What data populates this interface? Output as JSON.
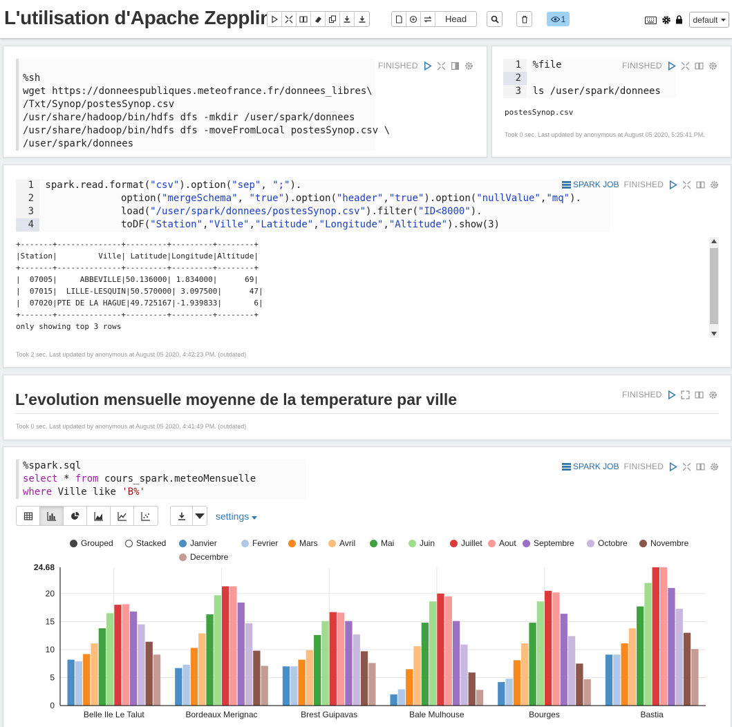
{
  "notebook": {
    "title": "L'utilisation d'Apache Zepplin",
    "head_label": "Head",
    "viewers": "1",
    "interpreter": "default"
  },
  "status_finished": "FINISHED",
  "spark_job": "SPARK JOB",
  "p1": {
    "lines": [
      "%sh",
      "wget https://donneespubliques.meteofrance.fr/donnees_libres\\",
      "/Txt/Synop/postesSynop.csv",
      "/usr/share/hadoop/bin/hdfs dfs -mkdir /user/spark/donnees",
      "/usr/share/hadoop/bin/hdfs dfs -moveFromLocal postesSynop.csv \\",
      "/user/spark/donnees"
    ]
  },
  "p2": {
    "line1": "%file",
    "line3": "ls /user/spark/donnees",
    "gutter": [
      "1",
      "2",
      "3"
    ],
    "output": "postesSynop.csv",
    "meta": "Took 0 sec. Last updated by anonymous at August 05 2020, 5:25:41 PM."
  },
  "p3": {
    "gutter": [
      "1",
      "2",
      "3",
      "4"
    ],
    "output": "+-------+--------------+---------+---------+--------+\n|Station|         Ville| Latitude|Longitude|Altitude|\n+-------+--------------+---------+---------+--------+\n|  07005|     ABBEVILLE|50.136000| 1.834000|      69|\n|  07015|  LILLE-LESQUIN|50.570000| 3.097500|      47|\n|  07020|PTE DE LA HAGUE|49.725167|-1.939833|       6|\n+-------+--------------+---------+---------+--------+\nonly showing top 3 rows",
    "meta": "Took 2 sec. Last updated by anonymous at August 05 2020, 4:42:23 PM. (outdated)"
  },
  "p4": {
    "heading": "L’evolution mensuelle moyenne de la temperature par ville",
    "meta": "Took 0 sec. Last updated by anonymous at August 05 2020, 4:41:49 PM. (outdated)"
  },
  "p5": {
    "line1": "%spark.sql",
    "line2_kw1": "select",
    "line2_mid": " * ",
    "line2_kw2": "from",
    "line2_rest": " cours_spark.meteoMensuelle",
    "line3_kw": "where",
    "line3_mid": " Ville like ",
    "line3_str": "'B%'",
    "settings": "settings",
    "grouped": "Grouped",
    "stacked": "Stacked"
  },
  "chart_data": {
    "type": "bar",
    "mode": "grouped",
    "categories": [
      "Belle Ile Le Talut",
      "Bordeaux Merignac",
      "Brest Guipavas",
      "Bale Mulhouse",
      "Bourges",
      "Bastia"
    ],
    "ylim": [
      0,
      24.68
    ],
    "yticks": [
      "0",
      "5",
      "10",
      "15",
      "20",
      "24.68"
    ],
    "series": [
      {
        "name": "Janvier",
        "color": "#4a8ec5",
        "values": [
          8.2,
          6.7,
          7.0,
          2.0,
          4.2,
          9.1
        ]
      },
      {
        "name": "Fevrier",
        "color": "#b0c9e8",
        "values": [
          7.9,
          7.3,
          7.0,
          2.9,
          4.8,
          9.1
        ]
      },
      {
        "name": "Mars",
        "color": "#f78a1e",
        "values": [
          9.2,
          10.3,
          8.2,
          6.5,
          8.1,
          11.1
        ]
      },
      {
        "name": "Avril",
        "color": "#fcbd7f",
        "values": [
          11.1,
          12.9,
          9.9,
          10.6,
          11.1,
          13.8
        ]
      },
      {
        "name": "Mai",
        "color": "#3ea23e",
        "values": [
          13.8,
          16.3,
          12.6,
          14.8,
          14.8,
          17.7
        ]
      },
      {
        "name": "Juin",
        "color": "#a0dc8e",
        "values": [
          16.5,
          19.7,
          15.1,
          18.6,
          18.6,
          21.9
        ]
      },
      {
        "name": "Juillet",
        "color": "#db3b3c",
        "values": [
          18.0,
          21.3,
          16.7,
          20.0,
          20.5,
          24.7
        ]
      },
      {
        "name": "Aout",
        "color": "#fa9a98",
        "values": [
          18.1,
          21.3,
          16.6,
          19.5,
          20.2,
          24.7
        ]
      },
      {
        "name": "Septembre",
        "color": "#9b72c3",
        "values": [
          16.8,
          18.4,
          15.1,
          15.1,
          16.4,
          21.0
        ]
      },
      {
        "name": "Octobre",
        "color": "#c8b8dd",
        "values": [
          14.5,
          14.7,
          12.7,
          10.9,
          12.4,
          17.3
        ]
      },
      {
        "name": "Novembre",
        "color": "#8c564b",
        "values": [
          11.4,
          9.8,
          9.7,
          5.9,
          7.5,
          13.0
        ]
      },
      {
        "name": "Decembre",
        "color": "#c59c94",
        "values": [
          9.1,
          7.1,
          7.6,
          2.8,
          4.7,
          10.1
        ]
      }
    ]
  }
}
